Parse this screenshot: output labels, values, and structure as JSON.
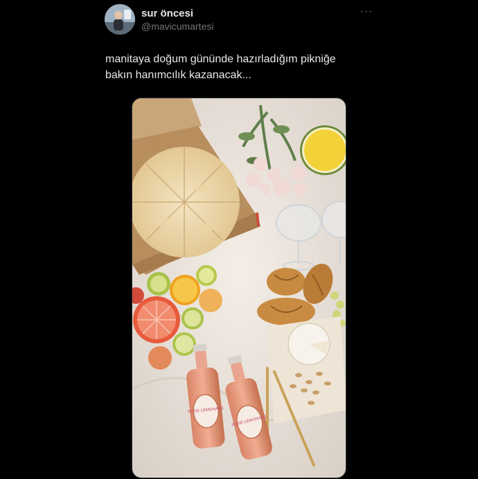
{
  "user": {
    "display_name": "sur öncesi",
    "handle": "@mavicumartesi"
  },
  "icons": {
    "more": "more-horizontal-icon",
    "avatar": "profile-photo"
  },
  "tweet": {
    "text_line1": "manitaya doğum gününde hazırladığım pikniğe",
    "text_line2": "bakın hanımcılık kazanacak..."
  },
  "media": {
    "bottle_label_1": "ROSE LEMONADE",
    "bottle_label_2": "ROSE LEMONADE"
  },
  "colors": {
    "background": "#000000",
    "primary_text": "#e7e9ea",
    "secondary_text": "#71767b"
  }
}
